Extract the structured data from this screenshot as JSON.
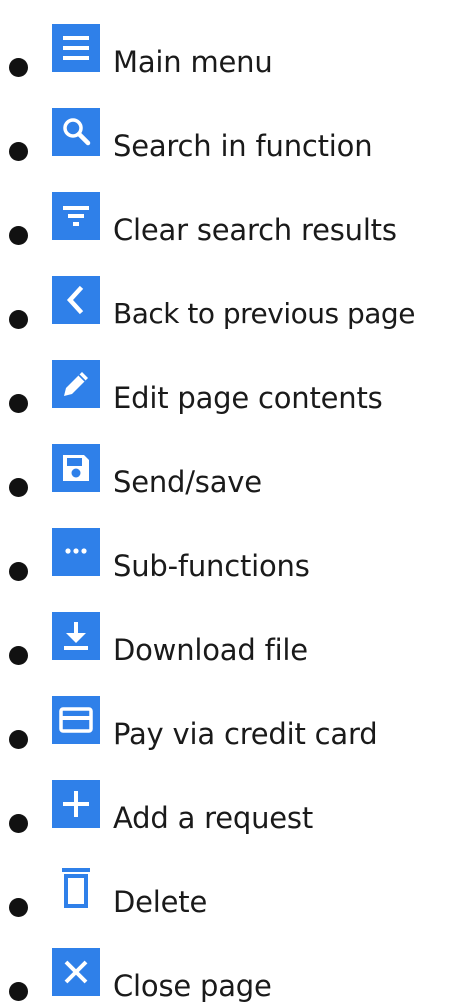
{
  "legend": {
    "items": [
      {
        "icon": "hamburger-menu-icon",
        "label": "Main menu"
      },
      {
        "icon": "magnifier-search-icon",
        "label": "Search in function"
      },
      {
        "icon": "filter-icon",
        "label": "Clear search results"
      },
      {
        "icon": "chevron-left-icon",
        "label": "Back to previous page"
      },
      {
        "icon": "pencil-edit-icon",
        "label": "Edit page contents"
      },
      {
        "icon": "floppy-disk-save-icon",
        "label": "Send/save"
      },
      {
        "icon": "ellipsis-more-icon",
        "label": "Sub-functions"
      },
      {
        "icon": "download-icon",
        "label": "Download file"
      },
      {
        "icon": "credit-card-icon",
        "label": "Pay via credit card"
      },
      {
        "icon": "plus-icon",
        "label": "Add a request"
      },
      {
        "icon": "trash-delete-icon",
        "label": "Delete"
      },
      {
        "icon": "close-x-icon",
        "label": "Close page"
      }
    ],
    "icon_color": "#2f80e9",
    "icon_glyph_color": "#ffffff",
    "text_color": "#1a1a1a"
  }
}
